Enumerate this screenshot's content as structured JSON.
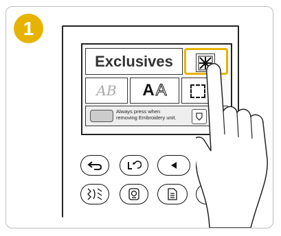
{
  "step": {
    "number": "1"
  },
  "screen": {
    "exclusives_label": "Exclusives",
    "font_sample": "A",
    "font_outline_sample": "A",
    "script_sample": "AB",
    "notice": [
      "Always press when",
      "removing Embroidery unit."
    ],
    "highlight_color": "#e6b400"
  },
  "controls": {
    "row1": [
      "back-button",
      "rotate-button",
      "left-arrow-button",
      "right-arrow-button"
    ],
    "row2": [
      "pattern-button",
      "embroidery-unit-button",
      "memory-button",
      "help-button"
    ]
  },
  "icons": {
    "pattern": "starburst-pattern-icon",
    "back": "return-arrow-icon",
    "frame": "dashed-frame-icon"
  }
}
